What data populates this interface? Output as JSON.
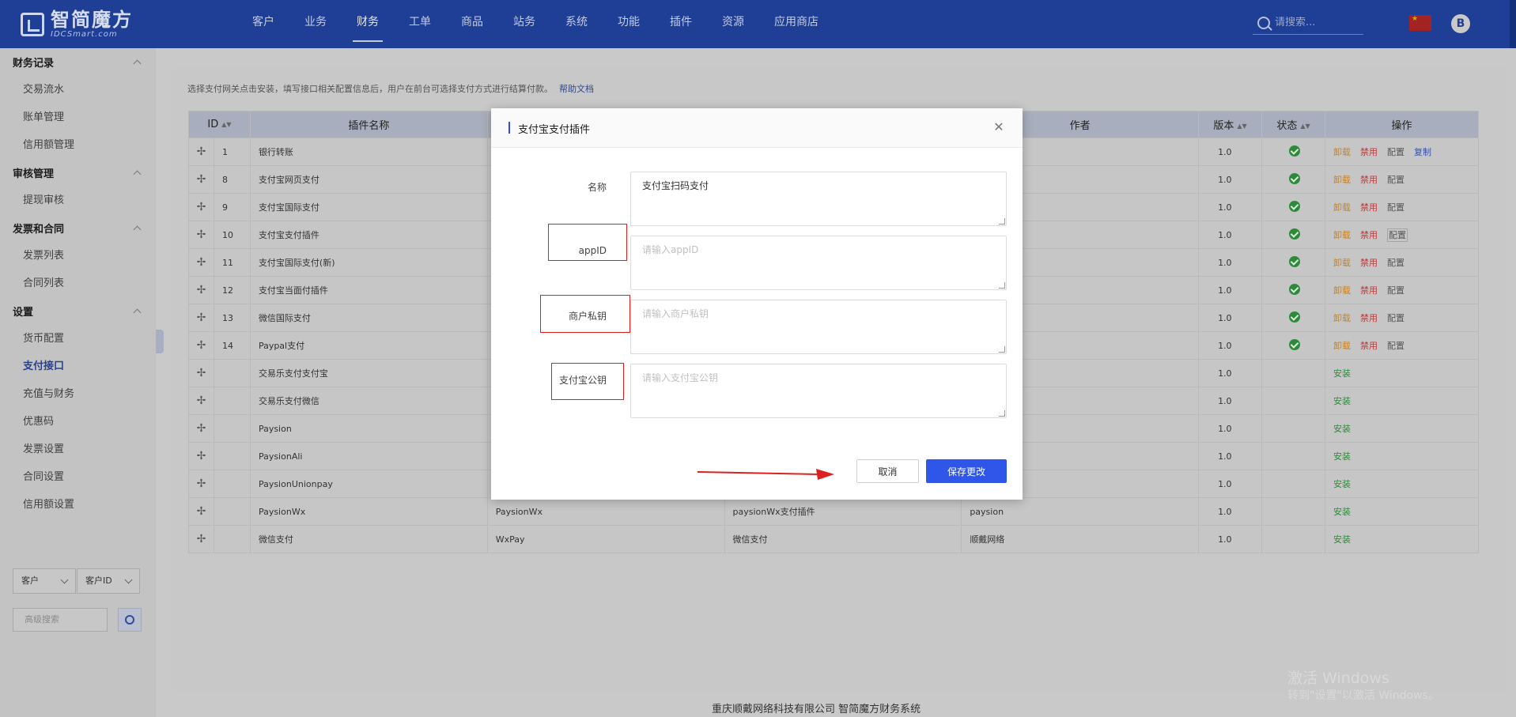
{
  "brand": {
    "name": "智简魔方",
    "sub": "IDCSmart.com"
  },
  "nav": [
    "客户",
    "业务",
    "财务",
    "工单",
    "商品",
    "站务",
    "系统",
    "功能",
    "插件",
    "资源",
    "应用商店"
  ],
  "nav_active": 2,
  "search": {
    "placeholder": "请搜索..."
  },
  "user_initial": "B",
  "sidebar": [
    {
      "title": "财务记录",
      "items": [
        "交易流水",
        "账单管理",
        "信用额管理"
      ]
    },
    {
      "title": "审核管理",
      "items": [
        "提现审核"
      ]
    },
    {
      "title": "发票和合同",
      "items": [
        "发票列表",
        "合同列表"
      ]
    },
    {
      "title": "设置",
      "items": [
        "货币配置",
        "支付接口",
        "充值与财务",
        "优惠码",
        "发票设置",
        "合同设置",
        "信用额设置"
      ]
    }
  ],
  "sidebar_active": "支付接口",
  "sidebar_bottom": {
    "select1": "客户",
    "select2": "客户ID",
    "adv_placeholder": "高级搜索"
  },
  "hint": {
    "text": "选择支付网关点击安装，填写接口相关配置信息后，用户在前台可选择支付方式进行结算付款。",
    "link": "帮助文档"
  },
  "table": {
    "headers": [
      "ID",
      "插件名称",
      "",
      "",
      "作者",
      "版本",
      "状态",
      "操作"
    ],
    "rows": [
      {
        "id": "1",
        "name": "银行转账",
        "code": "",
        "desc": "",
        "author": "",
        "version": "1.0",
        "status": true,
        "actions": [
          "卸载",
          "禁用",
          "配置",
          "复制"
        ]
      },
      {
        "id": "8",
        "name": "支付宝网页支付",
        "code": "",
        "desc": "",
        "author": "",
        "version": "1.0",
        "status": true,
        "actions": [
          "卸载",
          "禁用",
          "配置"
        ]
      },
      {
        "id": "9",
        "name": "支付宝国际支付",
        "code": "",
        "desc": "",
        "author": "",
        "version": "1.0",
        "status": true,
        "actions": [
          "卸载",
          "禁用",
          "配置"
        ]
      },
      {
        "id": "10",
        "name": "支付宝支付插件",
        "code": "",
        "desc": "",
        "author": "",
        "version": "1.0",
        "status": true,
        "actions": [
          "卸载",
          "禁用",
          "配置"
        ]
      },
      {
        "id": "11",
        "name": "支付宝国际支付(新)",
        "code": "",
        "desc": "",
        "author": "",
        "version": "1.0",
        "status": true,
        "actions": [
          "卸载",
          "禁用",
          "配置"
        ]
      },
      {
        "id": "12",
        "name": "支付宝当面付插件",
        "code": "",
        "desc": "",
        "author": "",
        "version": "1.0",
        "status": true,
        "actions": [
          "卸载",
          "禁用",
          "配置"
        ]
      },
      {
        "id": "13",
        "name": "微信国际支付",
        "code": "",
        "desc": "",
        "author": "",
        "version": "1.0",
        "status": true,
        "actions": [
          "卸载",
          "禁用",
          "配置"
        ]
      },
      {
        "id": "14",
        "name": "Paypal支付",
        "code": "",
        "desc": "",
        "author": "",
        "version": "1.0",
        "status": true,
        "actions": [
          "卸载",
          "禁用",
          "配置"
        ]
      },
      {
        "id": "",
        "name": "交易乐支付支付宝",
        "code": "",
        "desc": "",
        "author": "",
        "version": "1.0",
        "status": false,
        "actions": [
          "安装"
        ]
      },
      {
        "id": "",
        "name": "交易乐支付微信",
        "code": "",
        "desc": "",
        "author": "",
        "version": "1.0",
        "status": false,
        "actions": [
          "安装"
        ]
      },
      {
        "id": "",
        "name": "Paysion",
        "code": "",
        "desc": "",
        "author": "",
        "version": "1.0",
        "status": false,
        "actions": [
          "安装"
        ]
      },
      {
        "id": "",
        "name": "PaysionAli",
        "code": "",
        "desc": "",
        "author": "",
        "version": "1.0",
        "status": false,
        "actions": [
          "安装"
        ]
      },
      {
        "id": "",
        "name": "PaysionUnionpay",
        "code": "",
        "desc": "",
        "author": "",
        "version": "1.0",
        "status": false,
        "actions": [
          "安装"
        ]
      },
      {
        "id": "",
        "name": "PaysionWx",
        "code": "PaysionWx",
        "desc": "paysionWx支付插件",
        "author": "paysion",
        "version": "1.0",
        "status": false,
        "actions": [
          "安装"
        ]
      },
      {
        "id": "",
        "name": "微信支付",
        "code": "WxPay",
        "desc": "微信支付",
        "author": "顺戴网络",
        "version": "1.0",
        "status": false,
        "actions": [
          "安装"
        ]
      }
    ]
  },
  "footer": "重庆顺戴网络科技有限公司 智简魔方财务系统",
  "watermark": {
    "line1": "激活 Windows",
    "line2": "转到\"设置\"以激活 Windows。"
  },
  "modal": {
    "title": "支付宝支付插件",
    "fields": [
      {
        "label": "名称",
        "value": "支付宝扫码支付",
        "placeholder": ""
      },
      {
        "label": "appID",
        "value": "",
        "placeholder": "请输入appID"
      },
      {
        "label": "商户私钥",
        "value": "",
        "placeholder": "请输入商户私钥"
      },
      {
        "label": "支付宝公钥",
        "value": "",
        "placeholder": "请输入支付宝公钥"
      }
    ],
    "cancel": "取消",
    "save": "保存更改"
  },
  "colors": {
    "nav_bg": "#1f3e96",
    "primary": "#2f56e8",
    "highlight": "#e02020"
  }
}
